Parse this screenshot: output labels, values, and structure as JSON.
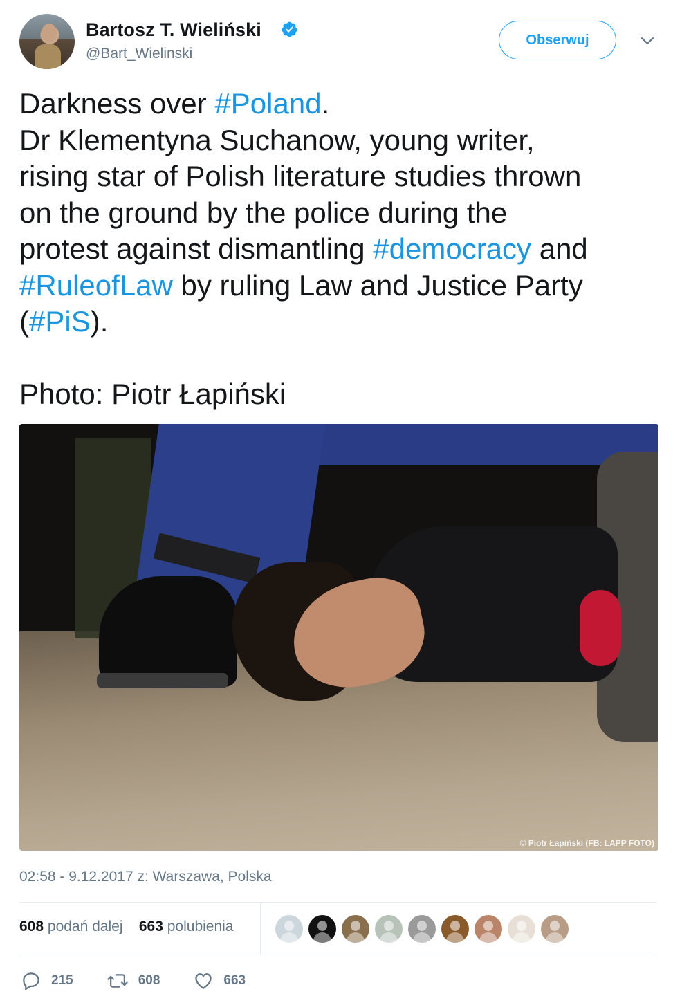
{
  "author": {
    "name": "Bartosz T. Wieliński",
    "handle": "@Bart_Wielinski",
    "verified": true
  },
  "follow_button": {
    "label": "Obserwuj"
  },
  "tweet": {
    "lines": [
      [
        {
          "t": "Darkness over "
        },
        {
          "t": "#Poland",
          "ht": true
        },
        {
          "t": "."
        }
      ],
      [
        {
          "t": "Dr Klementyna Suchanow, young writer,"
        }
      ],
      [
        {
          "t": "rising star of Polish literature studies thrown"
        }
      ],
      [
        {
          "t": "on the ground by the police during the"
        }
      ],
      [
        {
          "t": "protest against dismantling "
        },
        {
          "t": "#democracy",
          "ht": true
        },
        {
          "t": " and"
        }
      ],
      [
        {
          "t": "#RuleofLaw",
          "ht": true
        },
        {
          "t": " by ruling Law and Justice Party"
        }
      ],
      [
        {
          "t": "("
        },
        {
          "t": "#PiS",
          "ht": true
        },
        {
          "t": ")."
        }
      ],
      [
        {
          "t": " "
        }
      ],
      [
        {
          "t": "Photo:  Piotr Łapiński"
        }
      ]
    ],
    "photo_credit": "© Piotr Łapiński (FB: LAPP FOTO)"
  },
  "meta": {
    "timestamp": "02:58 - 9.12.2017 z: Warszawa, Polska"
  },
  "stats": {
    "retweets_count": "608",
    "retweets_label": "podań dalej",
    "likes_count": "663",
    "likes_label": "polubienia"
  },
  "likers": [
    {
      "icon": "default-avatar",
      "bg": "#ccd6dd"
    },
    {
      "icon": "dark-avatar",
      "bg": "#111111"
    },
    {
      "icon": "woman-avatar",
      "bg": "#8a6f4c"
    },
    {
      "icon": "group-avatar",
      "bg": "#b7c2b8"
    },
    {
      "icon": "bw-portrait-avatar",
      "bg": "#9a9a9a"
    },
    {
      "icon": "lion-avatar",
      "bg": "#8a5a2b"
    },
    {
      "icon": "man-avatar",
      "bg": "#b98468"
    },
    {
      "icon": "cat-avatar",
      "bg": "#e8e0d6"
    },
    {
      "icon": "elder-avatar",
      "bg": "#b89c86"
    }
  ],
  "actions": {
    "reply_count": "215",
    "retweet_count": "608",
    "like_count": "663"
  },
  "colors": {
    "accent": "#1da1f2",
    "hashtag": "#1b95e0",
    "muted": "#657786"
  }
}
